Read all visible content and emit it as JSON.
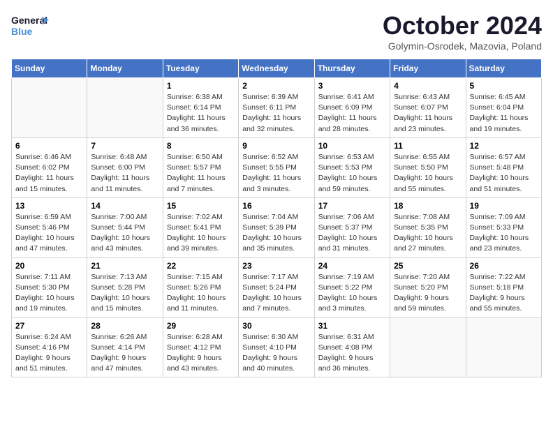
{
  "logo": {
    "line1": "General",
    "line2": "Blue"
  },
  "title": "October 2024",
  "location": "Golymin-Osrodek, Mazovia, Poland",
  "weekdays": [
    "Sunday",
    "Monday",
    "Tuesday",
    "Wednesday",
    "Thursday",
    "Friday",
    "Saturday"
  ],
  "weeks": [
    [
      {
        "day": "",
        "info": ""
      },
      {
        "day": "",
        "info": ""
      },
      {
        "day": "1",
        "info": "Sunrise: 6:38 AM\nSunset: 6:14 PM\nDaylight: 11 hours and 36 minutes."
      },
      {
        "day": "2",
        "info": "Sunrise: 6:39 AM\nSunset: 6:11 PM\nDaylight: 11 hours and 32 minutes."
      },
      {
        "day": "3",
        "info": "Sunrise: 6:41 AM\nSunset: 6:09 PM\nDaylight: 11 hours and 28 minutes."
      },
      {
        "day": "4",
        "info": "Sunrise: 6:43 AM\nSunset: 6:07 PM\nDaylight: 11 hours and 23 minutes."
      },
      {
        "day": "5",
        "info": "Sunrise: 6:45 AM\nSunset: 6:04 PM\nDaylight: 11 hours and 19 minutes."
      }
    ],
    [
      {
        "day": "6",
        "info": "Sunrise: 6:46 AM\nSunset: 6:02 PM\nDaylight: 11 hours and 15 minutes."
      },
      {
        "day": "7",
        "info": "Sunrise: 6:48 AM\nSunset: 6:00 PM\nDaylight: 11 hours and 11 minutes."
      },
      {
        "day": "8",
        "info": "Sunrise: 6:50 AM\nSunset: 5:57 PM\nDaylight: 11 hours and 7 minutes."
      },
      {
        "day": "9",
        "info": "Sunrise: 6:52 AM\nSunset: 5:55 PM\nDaylight: 11 hours and 3 minutes."
      },
      {
        "day": "10",
        "info": "Sunrise: 6:53 AM\nSunset: 5:53 PM\nDaylight: 10 hours and 59 minutes."
      },
      {
        "day": "11",
        "info": "Sunrise: 6:55 AM\nSunset: 5:50 PM\nDaylight: 10 hours and 55 minutes."
      },
      {
        "day": "12",
        "info": "Sunrise: 6:57 AM\nSunset: 5:48 PM\nDaylight: 10 hours and 51 minutes."
      }
    ],
    [
      {
        "day": "13",
        "info": "Sunrise: 6:59 AM\nSunset: 5:46 PM\nDaylight: 10 hours and 47 minutes."
      },
      {
        "day": "14",
        "info": "Sunrise: 7:00 AM\nSunset: 5:44 PM\nDaylight: 10 hours and 43 minutes."
      },
      {
        "day": "15",
        "info": "Sunrise: 7:02 AM\nSunset: 5:41 PM\nDaylight: 10 hours and 39 minutes."
      },
      {
        "day": "16",
        "info": "Sunrise: 7:04 AM\nSunset: 5:39 PM\nDaylight: 10 hours and 35 minutes."
      },
      {
        "day": "17",
        "info": "Sunrise: 7:06 AM\nSunset: 5:37 PM\nDaylight: 10 hours and 31 minutes."
      },
      {
        "day": "18",
        "info": "Sunrise: 7:08 AM\nSunset: 5:35 PM\nDaylight: 10 hours and 27 minutes."
      },
      {
        "day": "19",
        "info": "Sunrise: 7:09 AM\nSunset: 5:33 PM\nDaylight: 10 hours and 23 minutes."
      }
    ],
    [
      {
        "day": "20",
        "info": "Sunrise: 7:11 AM\nSunset: 5:30 PM\nDaylight: 10 hours and 19 minutes."
      },
      {
        "day": "21",
        "info": "Sunrise: 7:13 AM\nSunset: 5:28 PM\nDaylight: 10 hours and 15 minutes."
      },
      {
        "day": "22",
        "info": "Sunrise: 7:15 AM\nSunset: 5:26 PM\nDaylight: 10 hours and 11 minutes."
      },
      {
        "day": "23",
        "info": "Sunrise: 7:17 AM\nSunset: 5:24 PM\nDaylight: 10 hours and 7 minutes."
      },
      {
        "day": "24",
        "info": "Sunrise: 7:19 AM\nSunset: 5:22 PM\nDaylight: 10 hours and 3 minutes."
      },
      {
        "day": "25",
        "info": "Sunrise: 7:20 AM\nSunset: 5:20 PM\nDaylight: 9 hours and 59 minutes."
      },
      {
        "day": "26",
        "info": "Sunrise: 7:22 AM\nSunset: 5:18 PM\nDaylight: 9 hours and 55 minutes."
      }
    ],
    [
      {
        "day": "27",
        "info": "Sunrise: 6:24 AM\nSunset: 4:16 PM\nDaylight: 9 hours and 51 minutes."
      },
      {
        "day": "28",
        "info": "Sunrise: 6:26 AM\nSunset: 4:14 PM\nDaylight: 9 hours and 47 minutes."
      },
      {
        "day": "29",
        "info": "Sunrise: 6:28 AM\nSunset: 4:12 PM\nDaylight: 9 hours and 43 minutes."
      },
      {
        "day": "30",
        "info": "Sunrise: 6:30 AM\nSunset: 4:10 PM\nDaylight: 9 hours and 40 minutes."
      },
      {
        "day": "31",
        "info": "Sunrise: 6:31 AM\nSunset: 4:08 PM\nDaylight: 9 hours and 36 minutes."
      },
      {
        "day": "",
        "info": ""
      },
      {
        "day": "",
        "info": ""
      }
    ]
  ]
}
